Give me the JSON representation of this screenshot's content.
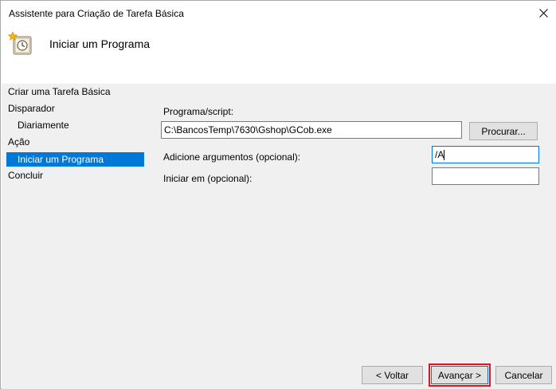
{
  "window": {
    "title": "Assistente para Criação de Tarefa Básica"
  },
  "header": {
    "heading": "Iniciar um Programa",
    "icon": "task-scheduler-clock-icon"
  },
  "nav": {
    "items": [
      {
        "label": "Criar uma Tarefa Básica",
        "level": 0,
        "selected": false
      },
      {
        "label": "Disparador",
        "level": 0,
        "selected": false
      },
      {
        "label": "Diariamente",
        "level": 1,
        "selected": false
      },
      {
        "label": "Ação",
        "level": 0,
        "selected": false
      },
      {
        "label": "Iniciar um Programa",
        "level": 1,
        "selected": true
      },
      {
        "label": "Concluir",
        "level": 0,
        "selected": false
      }
    ]
  },
  "form": {
    "program_label": "Programa/script:",
    "program_value": "C:\\BancosTemp\\7630\\Gshop\\GCob.exe",
    "browse_label": "Procurar...",
    "args_label": "Adicione argumentos (opcional):",
    "args_value": "/A",
    "start_in_label": "Iniciar em (opcional):",
    "start_in_value": ""
  },
  "footer": {
    "back_label": "< Voltar",
    "next_label": "Avançar >",
    "cancel_label": "Cancelar"
  },
  "colors": {
    "selection": "#0078d7",
    "highlight": "#e81123",
    "panel_bg": "#f0f0f0"
  }
}
